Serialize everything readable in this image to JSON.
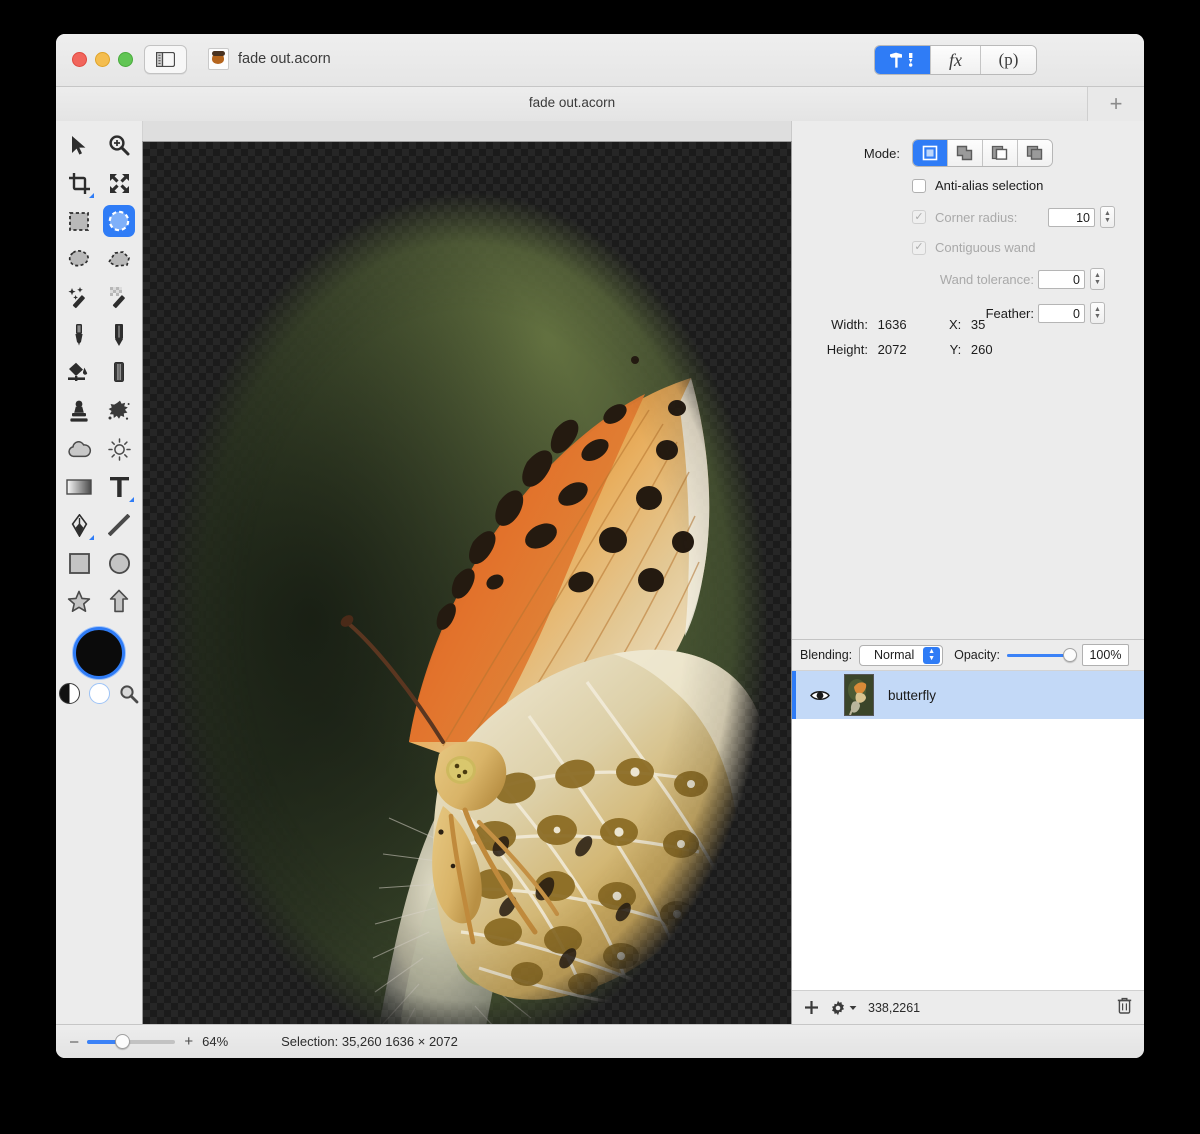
{
  "window": {
    "title": "fade out.acorn",
    "document_tab_title": "fade out.acorn",
    "traffic_lights": [
      "close",
      "minimize",
      "zoom"
    ],
    "sidebar_toggle_icon": "sidebar-icon",
    "new_tab_label": "+"
  },
  "toolbar": {
    "segments": [
      {
        "name": "tools",
        "label": "",
        "icon": "hammer-pen-icon",
        "active": true
      },
      {
        "name": "filters",
        "label": "fx",
        "icon": "fx-icon",
        "active": false
      },
      {
        "name": "palette",
        "label": "(p)",
        "icon": "p-icon",
        "active": false
      }
    ]
  },
  "tools_palette": {
    "items": [
      {
        "name": "move-tool",
        "icon": "arrow-cursor-icon",
        "active": false
      },
      {
        "name": "zoom-tool",
        "icon": "magnifier-plus-icon",
        "active": false
      },
      {
        "name": "crop-tool",
        "icon": "crop-icon",
        "active": false
      },
      {
        "name": "transform-tool",
        "icon": "four-arrows-icon",
        "active": false
      },
      {
        "name": "rectangular-select-tool",
        "icon": "marching-ants-rect-icon",
        "active": false
      },
      {
        "name": "elliptical-select-tool",
        "icon": "marching-ants-ellipse-icon",
        "active": true
      },
      {
        "name": "lasso-tool",
        "icon": "lasso-icon",
        "active": false
      },
      {
        "name": "polygon-lasso-tool",
        "icon": "polygon-lasso-icon",
        "active": false
      },
      {
        "name": "magic-wand-tool",
        "icon": "magic-wand-icon",
        "active": false
      },
      {
        "name": "instant-alpha-tool",
        "icon": "magic-wand-alpha-icon",
        "active": false
      },
      {
        "name": "brush-tool",
        "icon": "brush-icon",
        "active": false
      },
      {
        "name": "pencil-tool",
        "icon": "pencil-icon",
        "active": false
      },
      {
        "name": "paint-bucket-tool",
        "icon": "paint-bucket-icon",
        "active": false
      },
      {
        "name": "eraser-tool",
        "icon": "eraser-icon",
        "active": false
      },
      {
        "name": "clone-stamp-tool",
        "icon": "clone-stamp-icon",
        "active": false
      },
      {
        "name": "smudge-tool",
        "icon": "splatter-icon",
        "active": false
      },
      {
        "name": "blur-tool",
        "icon": "cloud-icon",
        "active": false
      },
      {
        "name": "dodge-tool",
        "icon": "sun-icon",
        "active": false
      },
      {
        "name": "gradient-tool",
        "icon": "gradient-icon",
        "active": false
      },
      {
        "name": "text-tool",
        "icon": "text-t-icon",
        "active": false
      },
      {
        "name": "bezier-tool",
        "icon": "fountain-pen-icon",
        "active": false
      },
      {
        "name": "line-tool",
        "icon": "line-icon",
        "active": false
      },
      {
        "name": "rectangle-shape-tool",
        "icon": "square-icon",
        "active": false
      },
      {
        "name": "ellipse-shape-tool",
        "icon": "circle-icon",
        "active": false
      },
      {
        "name": "star-shape-tool",
        "icon": "star-icon",
        "active": false
      },
      {
        "name": "arrow-shape-tool",
        "icon": "arrow-up-icon",
        "active": false
      }
    ],
    "foreground_color": "#0b0b0b",
    "background_color": "#ffffff",
    "swap_icon": "half-circle-icon",
    "eyedropper_icon": "magnifier-icon"
  },
  "inspector": {
    "mode_label": "Mode:",
    "modes": [
      {
        "name": "new-selection",
        "icon": "new-selection-icon",
        "active": true
      },
      {
        "name": "add-selection",
        "icon": "add-selection-icon",
        "active": false
      },
      {
        "name": "subtract-selection",
        "icon": "subtract-selection-icon",
        "active": false
      },
      {
        "name": "intersect-selection",
        "icon": "intersect-selection-icon",
        "active": false
      }
    ],
    "antialias": {
      "label": "Anti-alias selection",
      "checked": false,
      "enabled": true
    },
    "corner_radius": {
      "label": "Corner radius:",
      "checked": true,
      "enabled": false,
      "value": "10"
    },
    "contiguous_wand": {
      "label": "Contiguous wand",
      "checked": true,
      "enabled": false
    },
    "wand_tolerance": {
      "label": "Wand tolerance:",
      "enabled": false,
      "value": "0"
    },
    "feather": {
      "label": "Feather:",
      "enabled": true,
      "value": "0"
    },
    "dimensions": {
      "width_label": "Width:",
      "width_value": "1636",
      "height_label": "Height:",
      "height_value": "2072",
      "x_label": "X:",
      "x_value": "35",
      "y_label": "Y:",
      "y_value": "260"
    }
  },
  "layers": {
    "blending_label": "Blending:",
    "blending_value": "Normal",
    "opacity_label": "Opacity:",
    "opacity_value": "100%",
    "opacity_percent": 100,
    "items": [
      {
        "name": "butterfly",
        "visible": true,
        "selected": true,
        "visibility_icon": "eye-icon",
        "thumbnail": "layer-thumbnail"
      }
    ],
    "footer": {
      "add_label": "+",
      "add_icon": "plus-icon",
      "settings_icon": "gear-icon",
      "coordinates": "338,2261",
      "delete_icon": "trash-icon"
    }
  },
  "statusbar": {
    "zoom_out_label": "–",
    "zoom_in_label": "+",
    "zoom_value": "64%",
    "zoom_percent": 64,
    "selection_text": "Selection: 35,260 1636 × 2072"
  },
  "colors": {
    "accent": "#2f7cf6",
    "window_chrome": "#ececec",
    "selected_row": "#c3d9f7"
  }
}
